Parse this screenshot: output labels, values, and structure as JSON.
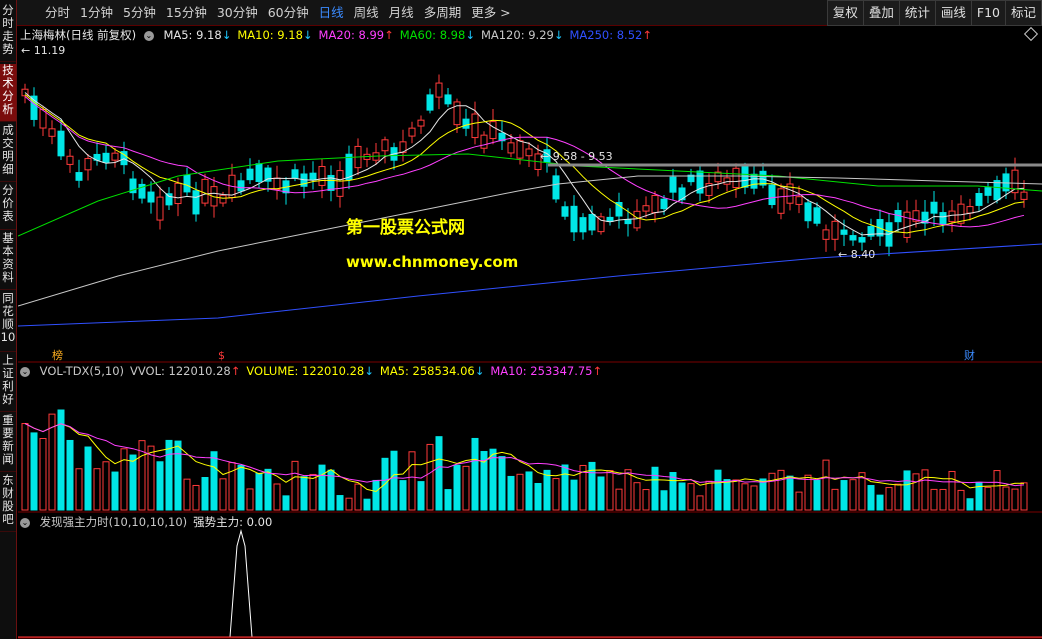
{
  "toolbar": {
    "tabs": [
      "分时",
      "1分钟",
      "5分钟",
      "15分钟",
      "30分钟",
      "60分钟",
      "日线",
      "周线",
      "月线",
      "多周期",
      "更多 >"
    ],
    "active_tab": "日线",
    "right_buttons": [
      "复权",
      "叠加",
      "统计",
      "画线",
      "F10",
      "标记"
    ]
  },
  "sidebar": {
    "items": [
      "分时走势",
      "技术分析",
      "成交明细",
      "分价表",
      "基本资料",
      "同花顺10",
      "上证利好",
      "重要新闻",
      "东财股吧"
    ],
    "active_item": "技术分析"
  },
  "price_panel": {
    "title": "上海梅林(日线 前复权)",
    "indicators": [
      {
        "label": "MA5: 9.18",
        "dir": "down",
        "color": "#e6e6e6"
      },
      {
        "label": "MA10: 9.18",
        "dir": "down",
        "color": "#ffff00"
      },
      {
        "label": "MA20: 8.99",
        "dir": "up",
        "color": "#ff40ff"
      },
      {
        "label": "MA60: 8.98",
        "dir": "down",
        "color": "#00e000"
      },
      {
        "label": "MA120: 9.29",
        "dir": "down",
        "color": "#c8c8c8"
      },
      {
        "label": "MA250: 8.52",
        "dir": "up",
        "color": "#3050ff"
      }
    ],
    "high_label": "11.19",
    "low_label": "8.40",
    "range_label": "9.58 - 9.53",
    "watermark_title": "第一股票公式网",
    "watermark_url": "www.chnmoney.com",
    "event_markers": [
      "榜",
      "$",
      "财"
    ]
  },
  "volume_panel": {
    "indicators": [
      {
        "label": "VOL-TDX(5,10)",
        "dir": "",
        "color": "#c8c8c8"
      },
      {
        "label": "VVOL: 122010.28",
        "dir": "up",
        "color": "#c8c8c8"
      },
      {
        "label": "VOLUME: 122010.28",
        "dir": "down",
        "color": "#ffff00"
      },
      {
        "label": "MA5: 258534.06",
        "dir": "down",
        "color": "#ffff00"
      },
      {
        "label": "MA10: 253347.75",
        "dir": "up",
        "color": "#ff40ff"
      }
    ]
  },
  "signal_panel": {
    "indicators": [
      {
        "label": "发现强主力时(10,10,10,10)",
        "dir": "",
        "color": "#c8c8c8"
      },
      {
        "label": "强势主力: 0.00",
        "dir": "",
        "color": "#e6e6e6"
      }
    ]
  },
  "colors": {
    "up_candle": "#ff3a3a",
    "down_candle": "#00e6e6",
    "ma5": "#e6e6e6",
    "ma10": "#ffff00",
    "ma20": "#ff40ff",
    "ma60": "#00e000",
    "ma120": "#c8c8c8",
    "ma250": "#3050ff",
    "watermark": "#ffff00"
  }
}
